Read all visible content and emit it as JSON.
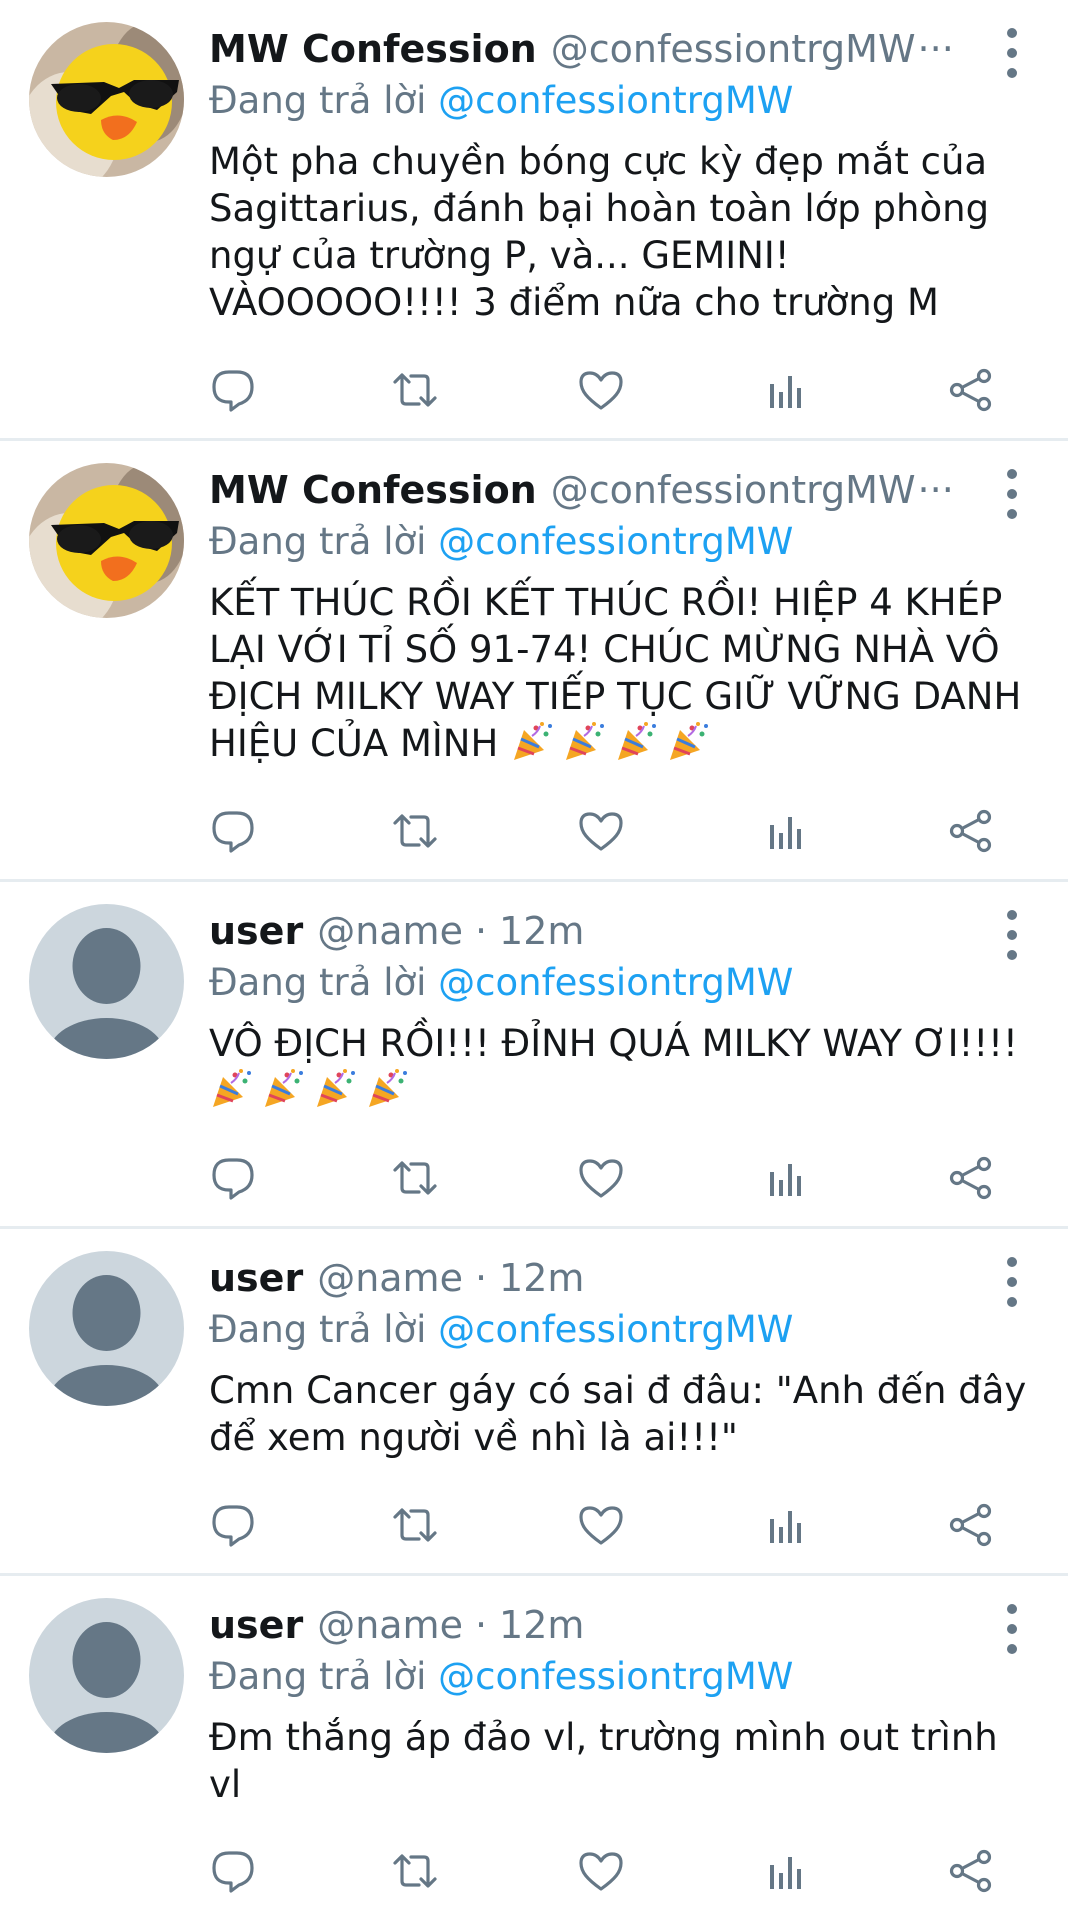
{
  "tweets": [
    {
      "name": "MW Confession",
      "handle": "@confessiontrgMW",
      "truncation": "···",
      "time": "",
      "reply_prefix": "Đang trả lời ",
      "reply_to": "@confessiontrgMW",
      "text": "Một pha chuyền bóng cực kỳ đẹp mắt của Sagittarius, đánh bại hoàn toàn lớp phòng ngự của trường P, và... GEMINI! VÀOOOOO!!!! 3 điểm nữa cho trường M",
      "avatar": "duck-sunglasses-avatar",
      "emoji_count": 0
    },
    {
      "name": "MW Confession",
      "handle": "@confessiontrgMW",
      "truncation": "···",
      "time": "",
      "reply_prefix": "Đang trả lời ",
      "reply_to": "@confessiontrgMW",
      "text": "KẾT THÚC RỒI KẾT THÚC RỒI! HIỆP 4 KHÉP LẠI VỚI TỈ SỐ 91-74! CHÚC MỪNG NHÀ VÔ ĐỊCH MILKY WAY TIẾP TỤC GIỮ VỮNG DANH HIỆU CỦA MÌNH ",
      "avatar": "duck-sunglasses-avatar",
      "emoji_count": 4
    },
    {
      "name": "user",
      "handle": "@name",
      "truncation": "",
      "time": "12m",
      "reply_prefix": "Đang trả lời ",
      "reply_to": "@confessiontrgMW",
      "text": "VÔ ĐỊCH RỒI!!! ĐỈNH QUÁ MILKY WAY ƠI!!!! ",
      "avatar": "default-user-avatar",
      "emoji_count": 4
    },
    {
      "name": "user",
      "handle": "@name",
      "truncation": "",
      "time": "12m",
      "reply_prefix": "Đang trả lời ",
      "reply_to": "@confessiontrgMW",
      "text": "Cmn Cancer gáy có sai đ đâu: \"Anh đến đây để xem người về nhì là ai!!!\"",
      "avatar": "default-user-avatar",
      "emoji_count": 0
    },
    {
      "name": "user",
      "handle": "@name",
      "truncation": "",
      "time": "12m",
      "reply_prefix": "Đang trả lời ",
      "reply_to": "@confessiontrgMW",
      "text": "Đm thắng áp đảo vl, trường mình out trình vl",
      "avatar": "default-user-avatar",
      "emoji_count": 0
    }
  ],
  "separator": "·",
  "icons": {
    "reply": "reply-icon",
    "retweet": "retweet-icon",
    "like": "heart-icon",
    "views": "analytics-icon",
    "share": "share-icon",
    "more": "more-vertical-icon",
    "emoji": "party-popper-icon"
  },
  "colors": {
    "text": "#14171a",
    "secondary": "#657786",
    "link": "#1da1f2",
    "divider": "#e6ecf0",
    "default_avatar_bg": "#ccd6dd",
    "default_avatar_fg": "#657786"
  }
}
